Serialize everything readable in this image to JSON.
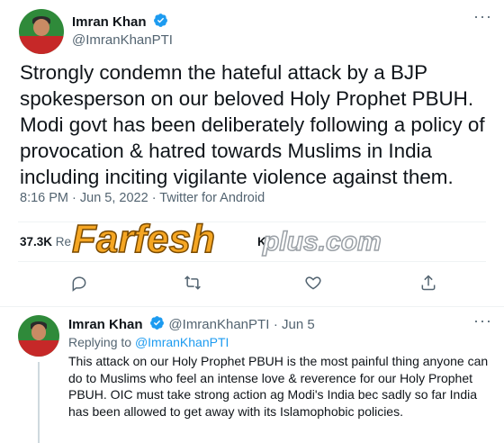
{
  "main_tweet": {
    "author_name": "Imran Khan",
    "author_handle": "@ImranKhanPTI",
    "text": "Strongly condemn the hateful attack by a BJP spokesperson on our beloved Holy Prophet PBUH. Modi govt has been deliberately following a policy of provocation & hatred towards Muslims in India including inciting vigilante violence against them.",
    "timestamp": "8:16 PM · Jun 5, 2022 · Twitter for Android",
    "retweets_count": "37.3K",
    "retweets_label": "Re",
    "partial_label": "K"
  },
  "watermark": {
    "text_main": "Farfesh",
    "text_suffix": "plus.com"
  },
  "reply_tweet": {
    "author_name": "Imran Khan",
    "author_handle": "@ImranKhanPTI",
    "date": "· Jun 5",
    "replying_prefix": "Replying to",
    "replying_handle": "@ImranKhanPTI",
    "text": "This attack on our Holy Prophet PBUH is the most painful thing anyone can do to Muslims who feel an intense love & reverence for our Holy Prophet PBUH. OIC must take strong action ag Modi's India bec sadly so far India has been allowed to get away with its Islamophobic policies."
  },
  "icons": {
    "verified": "verified-badge-icon",
    "more": "more-options-icon",
    "reply": "reply-icon",
    "retweet": "retweet-icon",
    "like": "like-icon",
    "share": "share-icon"
  },
  "colors": {
    "accent": "#1d9bf0",
    "muted": "#536471",
    "watermark_orange": "#f5a623"
  }
}
